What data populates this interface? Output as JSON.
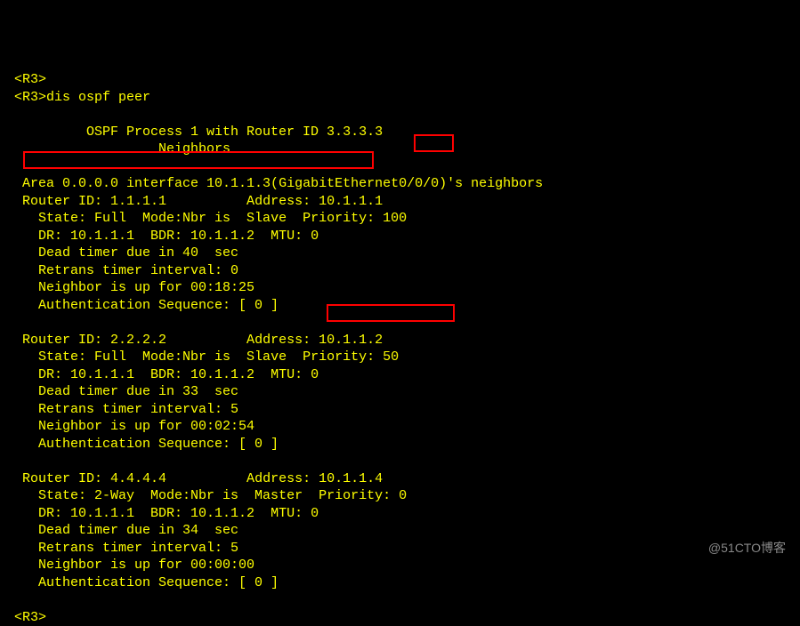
{
  "prompt_top": "<R3>",
  "command": "dis ospf peer",
  "header_line1": "OSPF Process 1 with Router ID 3.3.3.3",
  "header_line2": "Neighbors",
  "area_line": "Area 0.0.0.0 interface 10.1.1.3(GigabitEthernet0/0/0)'s neighbors",
  "neighbors": [
    {
      "router_id": "1.1.1.1",
      "address": "10.1.1.1",
      "state": "Full",
      "mode": "Nbr is  Slave",
      "priority": "100",
      "dr": "10.1.1.1",
      "bdr": "10.1.1.2",
      "mtu": "0",
      "dead_timer": "40",
      "retrans_timer": "0",
      "up_time": "00:18:25",
      "auth_seq": "[ 0 ]"
    },
    {
      "router_id": "2.2.2.2",
      "address": "10.1.1.2",
      "state": "Full",
      "mode": "Nbr is  Slave",
      "priority": "50",
      "dr": "10.1.1.1",
      "bdr": "10.1.1.2",
      "mtu": "0",
      "dead_timer": "33",
      "retrans_timer": "5",
      "up_time": "00:02:54",
      "auth_seq": "[ 0 ]"
    },
    {
      "router_id": "4.4.4.4",
      "address": "10.1.1.4",
      "state": "2-Way",
      "mode": "Nbr is  Master",
      "priority": "0",
      "dr": "10.1.1.1",
      "bdr": "10.1.1.2",
      "mtu": "0",
      "dead_timer": "34",
      "retrans_timer": "5",
      "up_time": "00:00:00",
      "auth_seq": "[ 0 ]"
    }
  ],
  "prompt_bottom": "<R3>",
  "watermark": "@51CTO博客",
  "line_prev": "<R3>"
}
